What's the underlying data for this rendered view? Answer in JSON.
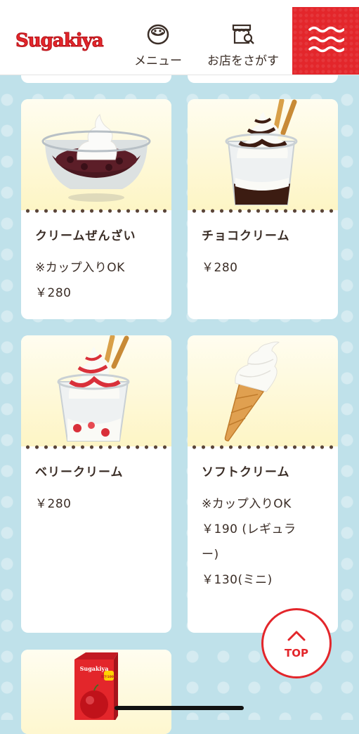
{
  "header": {
    "logo_text": "Sugakiya",
    "nav": [
      {
        "label": "メニュー",
        "icon": "bowl-icon"
      },
      {
        "label": "お店をさがす",
        "icon": "store-search-icon"
      }
    ],
    "menu_icon": "hamburger-wave-icon"
  },
  "products": [
    {
      "name": "クリームぜんざい",
      "lines": [
        "※カップ入りOK",
        "￥280"
      ],
      "image": "cream-zenzai-image"
    },
    {
      "name": "チョコクリーム",
      "lines": [
        "￥280"
      ],
      "image": "choco-cream-image"
    },
    {
      "name": "ベリークリーム",
      "lines": [
        "￥280"
      ],
      "image": "berry-cream-image"
    },
    {
      "name": "ソフトクリーム",
      "lines": [
        "※カップ入りOK",
        "￥190 (レギュラ",
        "ー)",
        "￥130(ミニ)"
      ],
      "image": "soft-cream-cone-image"
    }
  ],
  "partial_card": {
    "image": "apple-juice-pack-image",
    "pack_label": "Sugakiya",
    "pack_badge": "果汁100%"
  },
  "top_button": {
    "label": "TOP"
  },
  "colors": {
    "accent": "#e3262b",
    "background": "#bfe1ea",
    "text": "#3b2e27",
    "card_image_bg": "#fdf5c5"
  }
}
